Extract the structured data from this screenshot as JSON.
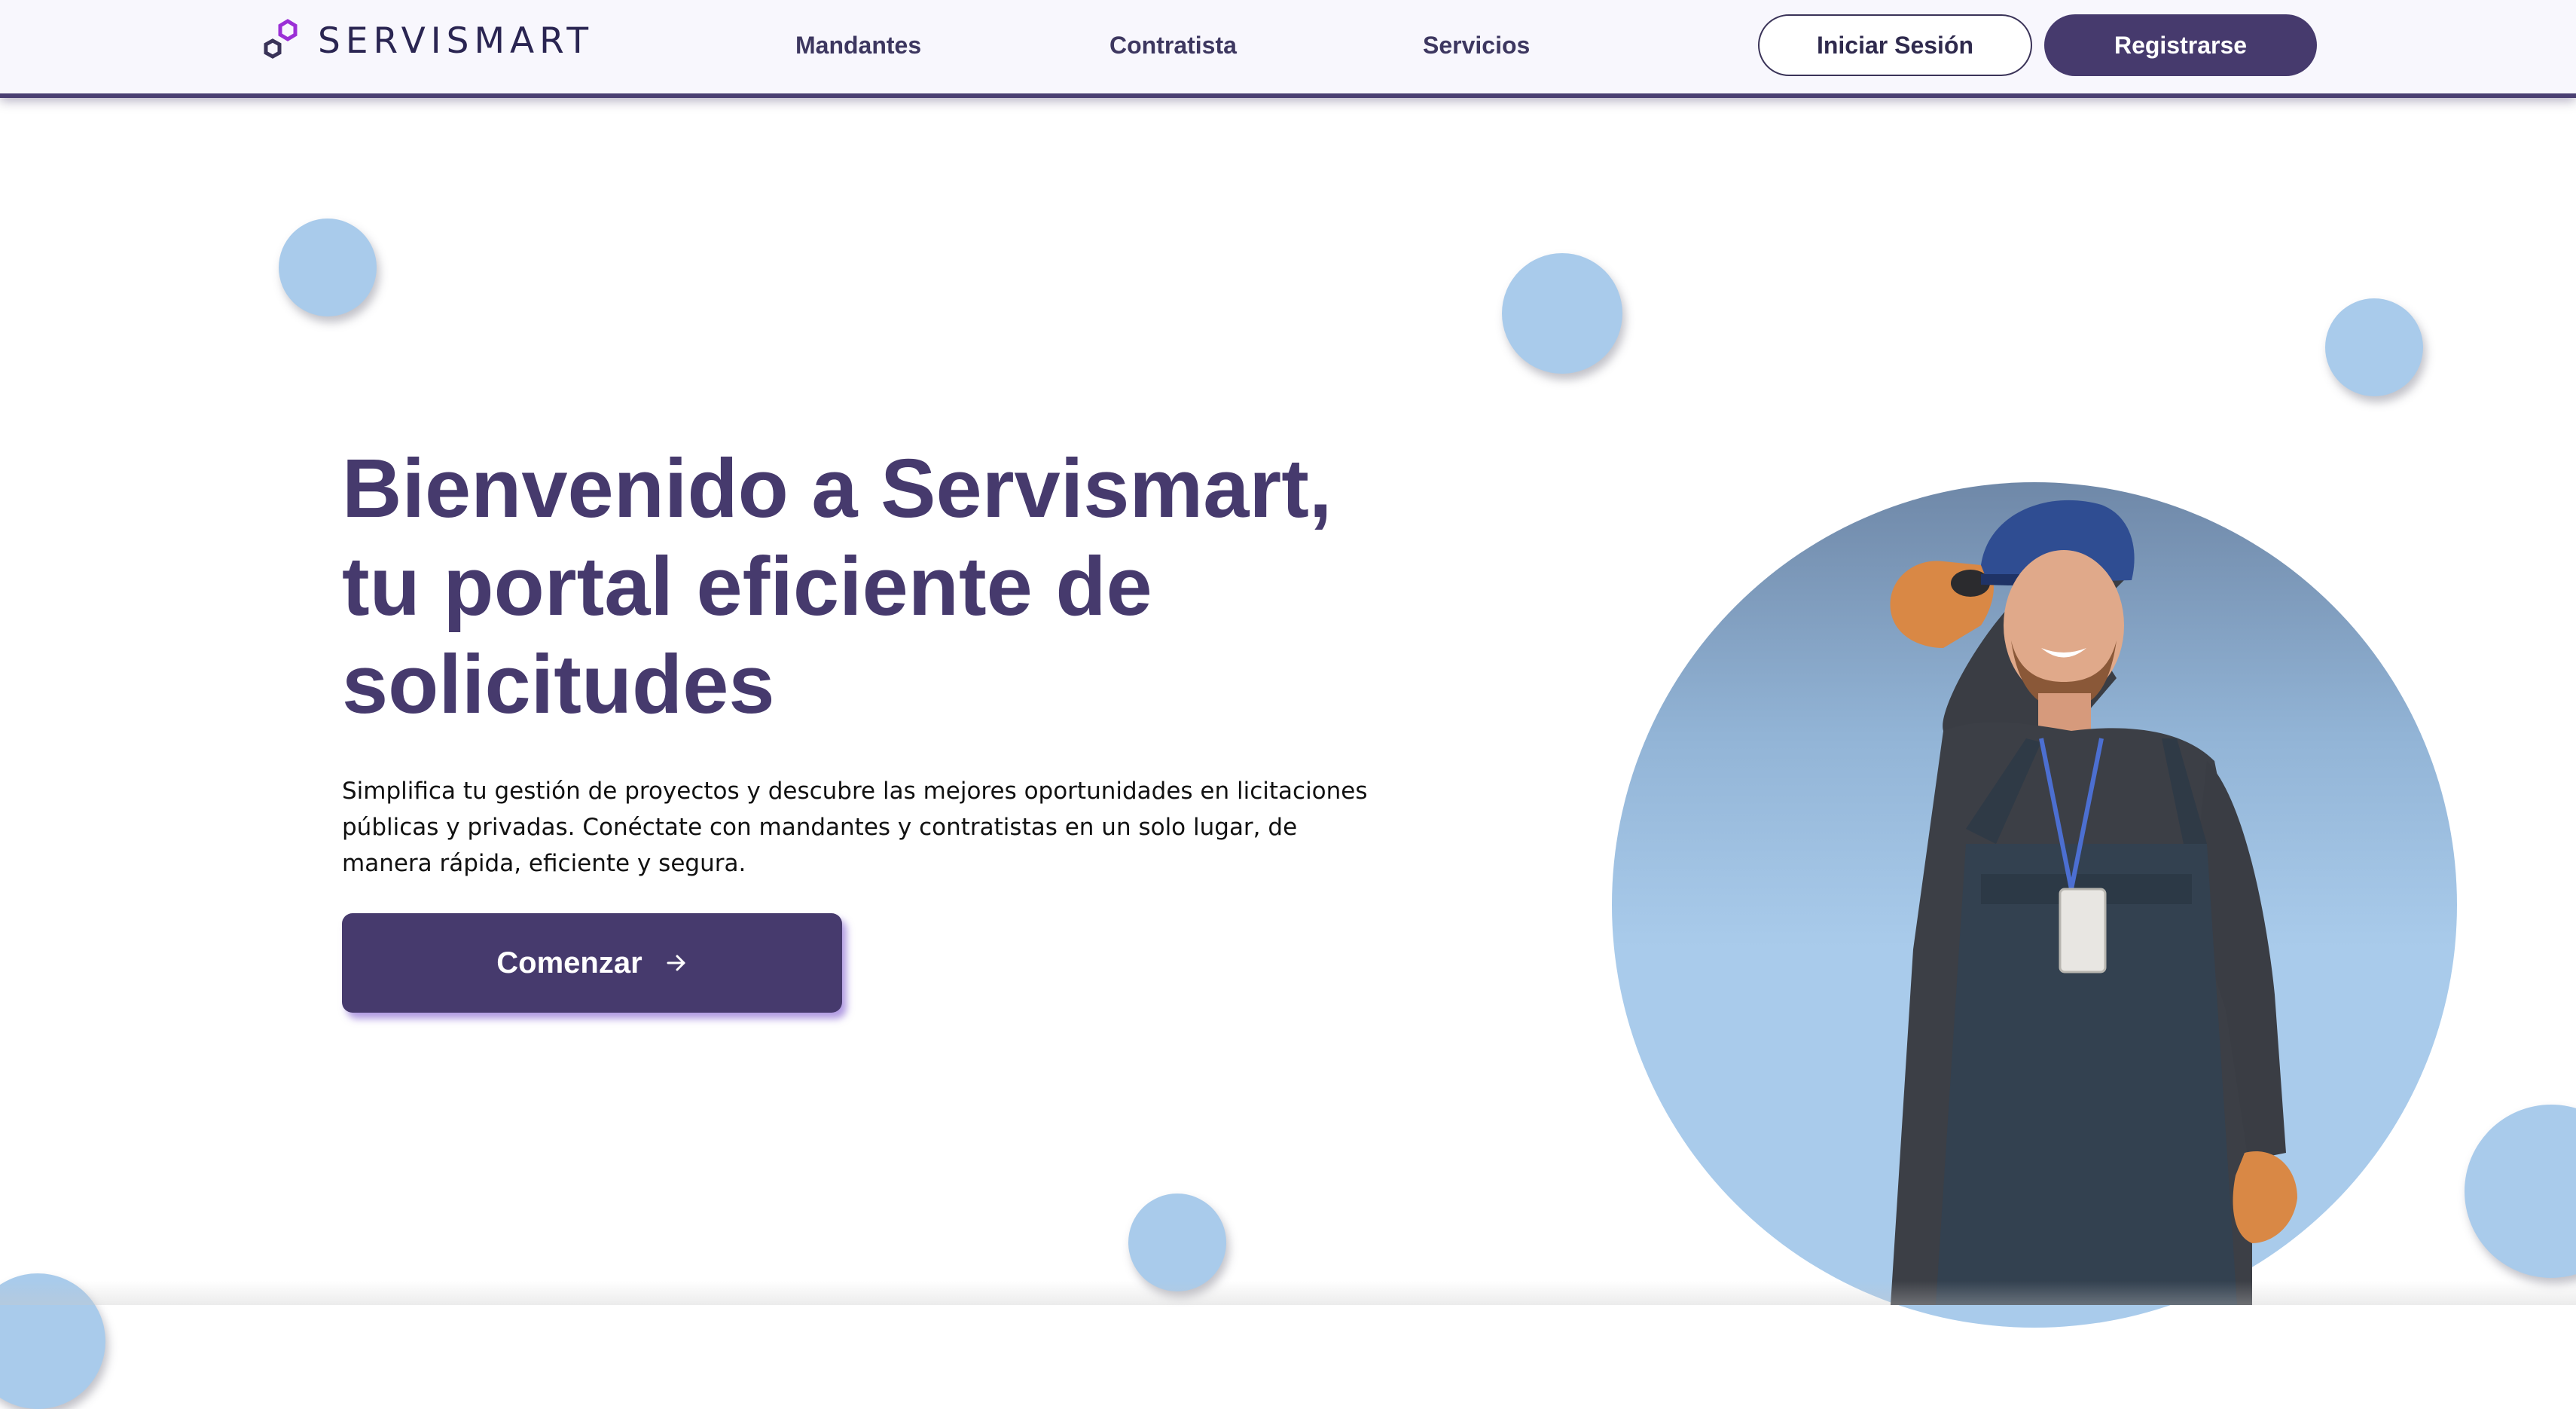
{
  "brand": {
    "name": "SERVISMART"
  },
  "nav": {
    "links": [
      {
        "label": "Mandantes"
      },
      {
        "label": "Contratista"
      },
      {
        "label": "Servicios"
      }
    ],
    "login_label": "Iniciar Sesión",
    "register_label": "Registrarse"
  },
  "hero": {
    "title": "Bienvenido a Servismart, tu portal eficiente de solicitudes",
    "description": "Simplifica tu gestión de proyectos y descubre las mejores oportunidades en licitaciones públicas y privadas. Conéctate con mandantes y contratistas en un solo lugar, de manera rápida, eficiente y segura.",
    "cta_label": "Comenzar",
    "cta_icon": "arrow-right-icon",
    "image": "worker-photo"
  },
  "colors": {
    "primary": "#463a6d",
    "accent_logo": "#9b2fd6",
    "bubble": "#a9cbeb",
    "nav_background": "#f8f7fd"
  }
}
